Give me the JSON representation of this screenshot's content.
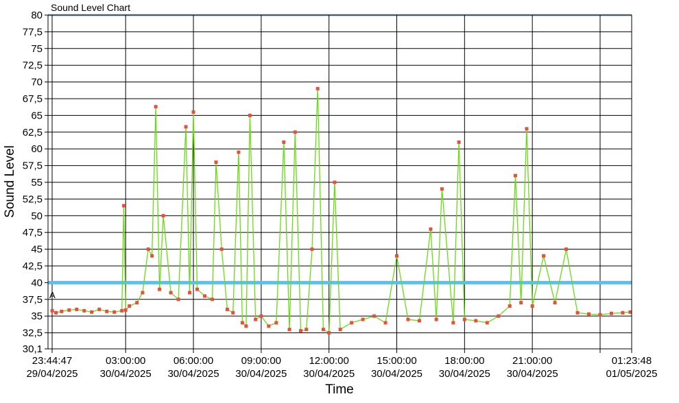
{
  "window": {
    "title": "Sound Level Chart"
  },
  "colors": {
    "line": "#66dd11",
    "point": "#e8503a",
    "threshold": "#5bc0f0",
    "grid": "#000000",
    "top_band": "#9bb7cf"
  },
  "chart_data": {
    "type": "line",
    "title": "Sound Level Chart",
    "xlabel": "Time",
    "ylabel": "Sound Level",
    "ylim": [
      30.1,
      80
    ],
    "y_ticks": [
      "80",
      "77,5",
      "75",
      "72,5",
      "70",
      "67,5",
      "65",
      "62,5",
      "60",
      "57,5",
      "55",
      "52,5",
      "50",
      "47,5",
      "45",
      "42,5",
      "40",
      "37,5",
      "35",
      "32,5",
      "30,1"
    ],
    "y_tick_values": [
      80,
      77.5,
      75,
      72.5,
      70,
      67.5,
      65,
      62.5,
      60,
      57.5,
      55,
      52.5,
      50,
      47.5,
      45,
      42.5,
      40,
      37.5,
      35,
      32.5,
      30.1
    ],
    "x_range": [
      "29/04/2025 23:44:47",
      "01/05/2025 01:23:48"
    ],
    "x_ticks": [
      {
        "time": "23:44:47",
        "date": "29/04/2025"
      },
      {
        "time": "03:00:00",
        "date": "30/04/2025"
      },
      {
        "time": "06:00:00",
        "date": "30/04/2025"
      },
      {
        "time": "09:00:00",
        "date": "30/04/2025"
      },
      {
        "time": "12:00:00",
        "date": "30/04/2025"
      },
      {
        "time": "15:00:00",
        "date": "30/04/2025"
      },
      {
        "time": "18:00:00",
        "date": "30/04/2025"
      },
      {
        "time": "21:00:00",
        "date": "30/04/2025"
      },
      {
        "time": "01:23:48",
        "date": "01/05/2025"
      }
    ],
    "threshold": 40,
    "marker": {
      "label": "A",
      "time": "29/04/2025 23:44:47",
      "value": 37.5
    },
    "grid": true,
    "series": [
      {
        "x": [
          "29/04/2025 23:45",
          "29/04/2025 23:55",
          "30/04/2025 00:10",
          "30/04/2025 00:30",
          "30/04/2025 00:50",
          "30/04/2025 01:10",
          "30/04/2025 01:30",
          "30/04/2025 01:50",
          "30/04/2025 02:10",
          "30/04/2025 02:30",
          "30/04/2025 02:50",
          "30/04/2025 02:55",
          "30/04/2025 03:00",
          "30/04/2025 03:10",
          "30/04/2025 03:30",
          "30/04/2025 03:45",
          "30/04/2025 04:00",
          "30/04/2025 04:10",
          "30/04/2025 04:20",
          "30/04/2025 04:30",
          "30/04/2025 04:40",
          "30/04/2025 05:00",
          "30/04/2025 05:20",
          "30/04/2025 05:40",
          "30/04/2025 05:50",
          "30/04/2025 06:00",
          "30/04/2025 06:10",
          "30/04/2025 06:30",
          "30/04/2025 06:50",
          "30/04/2025 07:00",
          "30/04/2025 07:15",
          "30/04/2025 07:30",
          "30/04/2025 07:45",
          "30/04/2025 08:00",
          "30/04/2025 08:10",
          "30/04/2025 08:20",
          "30/04/2025 08:30",
          "30/04/2025 08:45",
          "30/04/2025 09:00",
          "30/04/2025 09:20",
          "30/04/2025 09:40",
          "30/04/2025 10:00",
          "30/04/2025 10:15",
          "30/04/2025 10:30",
          "30/04/2025 10:45",
          "30/04/2025 11:00",
          "30/04/2025 11:15",
          "30/04/2025 11:30",
          "30/04/2025 11:45",
          "30/04/2025 12:00",
          "30/04/2025 12:15",
          "30/04/2025 12:30",
          "30/04/2025 13:00",
          "30/04/2025 13:30",
          "30/04/2025 14:00",
          "30/04/2025 14:30",
          "30/04/2025 15:00",
          "30/04/2025 15:30",
          "30/04/2025 16:00",
          "30/04/2025 16:30",
          "30/04/2025 16:45",
          "30/04/2025 17:00",
          "30/04/2025 17:30",
          "30/04/2025 17:45",
          "30/04/2025 18:00",
          "30/04/2025 18:30",
          "30/04/2025 19:00",
          "30/04/2025 19:30",
          "30/04/2025 20:00",
          "30/04/2025 20:15",
          "30/04/2025 20:30",
          "30/04/2025 20:45",
          "30/04/2025 21:00",
          "30/04/2025 21:30",
          "30/04/2025 22:00",
          "30/04/2025 22:30",
          "30/04/2025 23:00",
          "30/04/2025 23:30",
          "01/05/2025 00:00",
          "01/05/2025 00:30",
          "01/05/2025 01:00",
          "01/05/2025 01:20"
        ],
        "values": [
          35.8,
          35.5,
          35.7,
          35.9,
          36.0,
          35.8,
          35.6,
          36.0,
          35.7,
          35.6,
          35.8,
          51.5,
          35.9,
          36.5,
          37.0,
          38.5,
          45.0,
          44.0,
          66.3,
          39.0,
          50.0,
          38.5,
          37.5,
          63.3,
          38.5,
          65.5,
          39.0,
          38.0,
          37.5,
          58.0,
          45.0,
          36.0,
          35.5,
          59.5,
          34.0,
          33.5,
          65.0,
          34.5,
          35.0,
          33.5,
          34.0,
          61.0,
          33.0,
          62.5,
          32.8,
          33.0,
          45.0,
          69.0,
          33.0,
          32.5,
          55.0,
          33.0,
          34.0,
          34.5,
          35.0,
          34.0,
          44.0,
          34.5,
          34.3,
          48.0,
          34.5,
          54.0,
          34.0,
          61.0,
          34.5,
          34.3,
          34.0,
          35.0,
          36.5,
          56.0,
          37.0,
          63.0,
          36.5,
          44.0,
          37.0,
          45.0,
          35.5,
          35.3,
          35.2,
          35.4,
          35.5,
          35.6
        ]
      }
    ]
  }
}
